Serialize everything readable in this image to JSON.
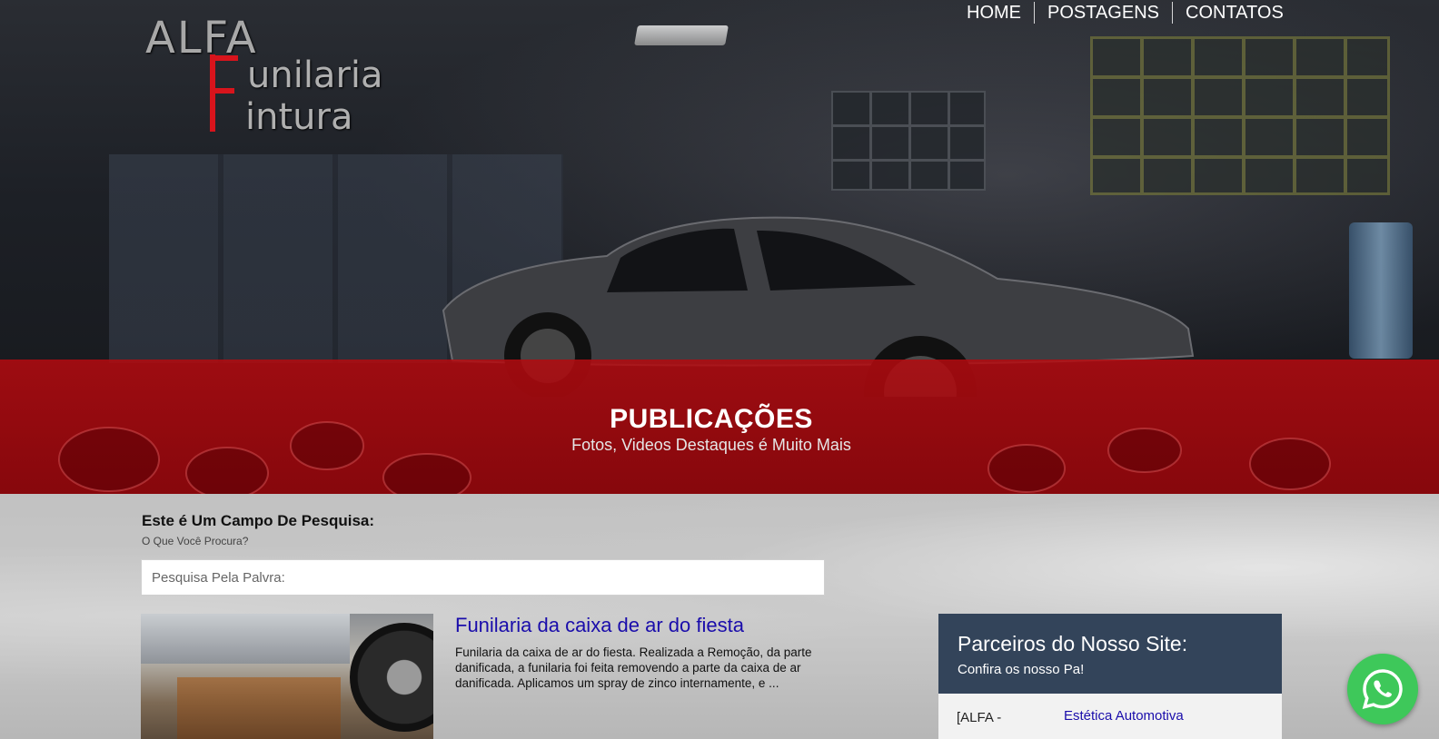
{
  "logo": {
    "word_alfa": "ALFA",
    "word_funilaria": "unilaria",
    "word_pintura": "intura"
  },
  "nav": {
    "items": [
      {
        "label": "HOME"
      },
      {
        "label": "POSTAGENS"
      },
      {
        "label": "CONTATOS"
      }
    ]
  },
  "hero": {
    "title": "PUBLICAÇÕES",
    "subtitle": "Fotos, Videos Destaques é Muito Mais"
  },
  "search": {
    "title": "Este é Um Campo De Pesquisa:",
    "subtitle": "O Que Você Procura?",
    "placeholder": "Pesquisa Pela Palvra:"
  },
  "post": {
    "title": "Funilaria da caixa de ar do fiesta",
    "excerpt": "Funilaria da caixa de ar do fiesta.  Realizada a Remoção, da parte danificada, a  funilaria foi feita removendo a parte da caixa de ar danificada.  Aplicamos um spray de zinco internamente, e ..."
  },
  "partners": {
    "title": "Parceiros do Nosso Site:",
    "subtitle": "Confira os nosso Pa!",
    "items": [
      {
        "image_alt": "[ALFA -",
        "link": "Estética Automotiva"
      }
    ]
  },
  "whatsapp": {
    "icon": "whatsapp-icon"
  },
  "colors": {
    "accent_red": "#c8101a",
    "partner_header": "#33445a",
    "link_blue": "#1a0dab",
    "whatsapp_green": "#3ec85a",
    "logo_red": "#d8141c"
  }
}
